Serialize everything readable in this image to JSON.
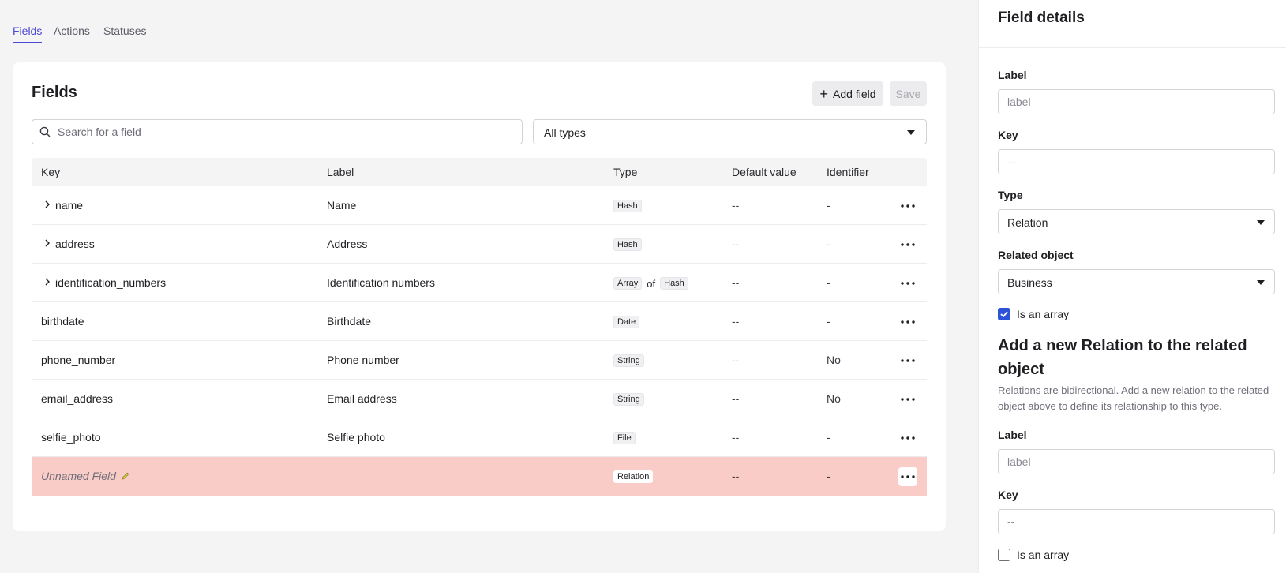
{
  "tabs": [
    {
      "label": "Fields",
      "active": true
    },
    {
      "label": "Actions",
      "active": false
    },
    {
      "label": "Statuses",
      "active": false
    }
  ],
  "card": {
    "title": "Fields",
    "add_field_label": "Add field",
    "save_label": "Save",
    "search_placeholder": "Search for a field",
    "type_filter_value": "All types"
  },
  "table": {
    "headers": {
      "key": "Key",
      "label": "Label",
      "type": "Type",
      "default_value": "Default value",
      "identifier": "Identifier"
    },
    "rows": [
      {
        "key": "name",
        "label": "Name",
        "type": "Hash",
        "default": "--",
        "identifier": "-"
      },
      {
        "key": "address",
        "label": "Address",
        "type": "Hash",
        "default": "--",
        "identifier": "-"
      },
      {
        "key": "identification_numbers",
        "label": "Identification numbers",
        "type": "Array",
        "type_of": "of",
        "type2": "Hash",
        "default": "--",
        "identifier": "-"
      },
      {
        "key": "birthdate",
        "label": "Birthdate",
        "type": "Date",
        "default": "--",
        "identifier": "-"
      },
      {
        "key": "phone_number",
        "label": "Phone number",
        "type": "String",
        "default": "--",
        "identifier": "No"
      },
      {
        "key": "email_address",
        "label": "Email address",
        "type": "String",
        "default": "--",
        "identifier": "No"
      },
      {
        "key": "selfie_photo",
        "label": "Selfie photo",
        "type": "File",
        "default": "--",
        "identifier": "-"
      },
      {
        "key": "Unnamed Field",
        "label": "",
        "type": "Relation",
        "default": "--",
        "identifier": "-"
      }
    ]
  },
  "details": {
    "title": "Field details",
    "label_label": "Label",
    "label_placeholder": "label",
    "key_label": "Key",
    "key_placeholder": "--",
    "type_label": "Type",
    "type_value": "Relation",
    "related_object_label": "Related object",
    "related_object_value": "Business",
    "is_array_label": "Is an array",
    "new_relation_heading": "Add a new Relation to the related object",
    "new_relation_desc": "Relations are bidirectional. Add a new relation to the related object above to define its relationship to this type.",
    "relation_label_label": "Label",
    "relation_label_placeholder": "label",
    "relation_key_label": "Key",
    "relation_key_placeholder": "--",
    "relation_is_array_label": "Is an array"
  },
  "colors": {
    "accent": "#4a48d4",
    "error_row": "#f9ccc7",
    "checkbox": "#2d54d8"
  }
}
